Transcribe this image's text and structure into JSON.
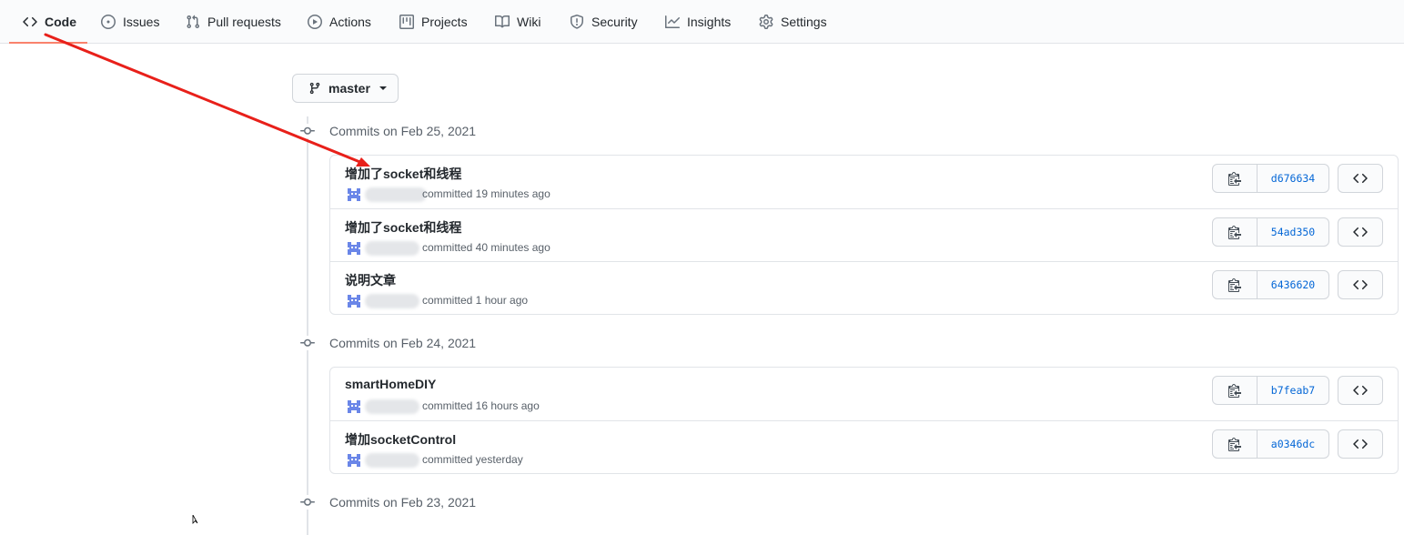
{
  "nav": {
    "tabs": [
      {
        "label": "Code",
        "icon": "code-icon",
        "selected": true
      },
      {
        "label": "Issues",
        "icon": "issue-icon"
      },
      {
        "label": "Pull requests",
        "icon": "pull-request-icon"
      },
      {
        "label": "Actions",
        "icon": "play-icon"
      },
      {
        "label": "Projects",
        "icon": "project-icon"
      },
      {
        "label": "Wiki",
        "icon": "book-icon"
      },
      {
        "label": "Security",
        "icon": "shield-icon"
      },
      {
        "label": "Insights",
        "icon": "graph-icon"
      },
      {
        "label": "Settings",
        "icon": "gear-icon"
      }
    ],
    "selected_underline_color": "#f9826c"
  },
  "branch": {
    "name": "master",
    "icon": "git-branch-icon"
  },
  "groups": [
    {
      "heading": "Commits on Feb 25, 2021",
      "commits": [
        {
          "title": "增加了socket和线程",
          "meta": "committed 19 minutes ago",
          "sha": "d676634"
        },
        {
          "title": "增加了socket和线程",
          "meta": "committed 40 minutes ago",
          "sha": "54ad350"
        },
        {
          "title": "说明文章",
          "meta": "committed 1 hour ago",
          "sha": "6436620"
        }
      ]
    },
    {
      "heading": "Commits on Feb 24, 2021",
      "commits": [
        {
          "title": "smartHomeDIY",
          "meta": "committed 16 hours ago",
          "sha": "b7feab7"
        },
        {
          "title": "增加socketControl",
          "meta": "committed yesterday",
          "sha": "a0346dc"
        }
      ]
    },
    {
      "heading": "Commits on Feb 23, 2021",
      "commits": []
    }
  ],
  "colors": {
    "link": "#0366d6",
    "annotation_arrow": "#e8201a",
    "avatar": "#6a86e8"
  }
}
